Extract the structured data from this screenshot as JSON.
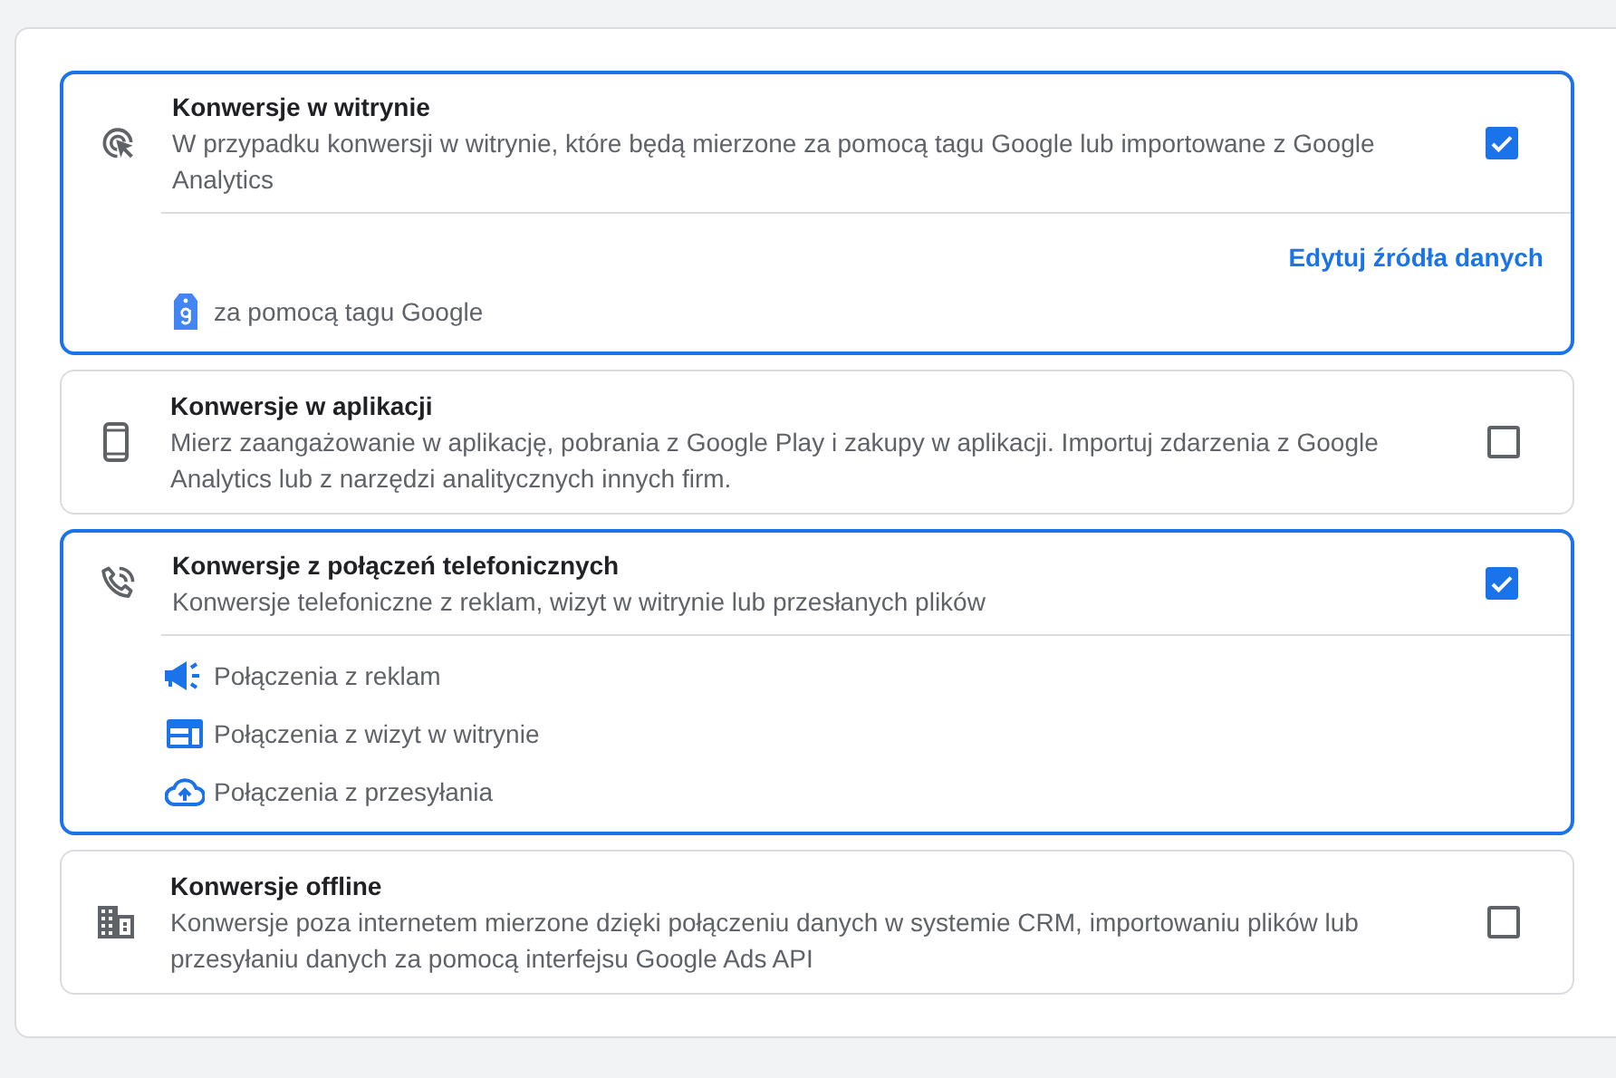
{
  "options": [
    {
      "kind": "target",
      "title": "Konwersje w witrynie",
      "description": "W przypadku konwersji w witrynie, które będą mierzone za pomocą tagu Google lub importowane z Google Analytics",
      "checked": true,
      "link": "Edytuj źródła danych",
      "sources": [
        {
          "kind": "tag",
          "label": "za pomocą tagu Google"
        }
      ]
    },
    {
      "kind": "phone",
      "title": "Konwersje w aplikacji",
      "description": "Mierz zaangażowanie w aplikację, pobrania z Google Play i zakupy w aplikacji. Importuj zdarzenia z Google Analytics lub z narzędzi analitycznych innych firm.",
      "checked": false
    },
    {
      "kind": "call",
      "title": "Konwersje z połączeń telefonicznych",
      "description": "Konwersje telefoniczne z reklam, wizyt w witrynie lub przesłanych plików",
      "checked": true,
      "sources": [
        {
          "kind": "megaphone",
          "label": "Połączenia z reklam"
        },
        {
          "kind": "web",
          "label": "Połączenia z wizyt w witrynie"
        },
        {
          "kind": "upload",
          "label": "Połączenia z przesyłania"
        }
      ]
    },
    {
      "kind": "building",
      "title": "Konwersje offline",
      "description": "Konwersje poza internetem mierzone dzięki połączeniu danych w systemie CRM, importowaniu plików lub przesyłaniu danych za pomocą interfejsu Google Ads API",
      "checked": false
    }
  ]
}
